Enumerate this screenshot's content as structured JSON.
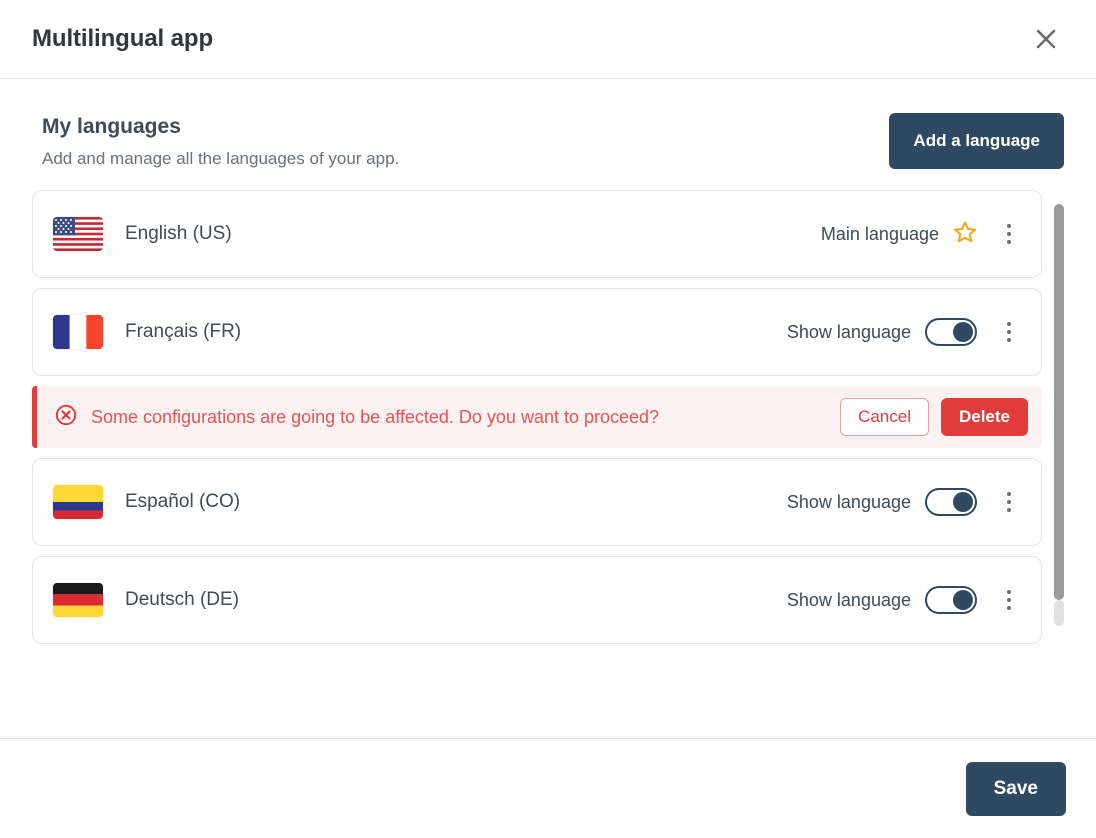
{
  "header": {
    "title": "Multilingual app",
    "close_icon": "close-icon"
  },
  "section": {
    "title": "My languages",
    "subtitle": "Add and manage all the languages of your app.",
    "add_button": "Add a language"
  },
  "languages": [
    {
      "name": "English (US)",
      "flag": "us",
      "status": "Main language",
      "control": "star",
      "star_icon": "star-icon",
      "menu_icon": "kebab-menu-icon"
    },
    {
      "name": "Français (FR)",
      "flag": "fr",
      "status": "Show language",
      "control": "toggle",
      "toggle_on": true,
      "menu_icon": "kebab-menu-icon"
    },
    {
      "name": "Español (CO)",
      "flag": "co",
      "status": "Show language",
      "control": "toggle",
      "toggle_on": true,
      "menu_icon": "kebab-menu-icon"
    },
    {
      "name": "Deutsch (DE)",
      "flag": "de",
      "status": "Show language",
      "control": "toggle",
      "toggle_on": true,
      "menu_icon": "kebab-menu-icon"
    }
  ],
  "alert": {
    "icon": "error-circle-x-icon",
    "message": "Some configurations are going to be affected. Do you want to proceed?",
    "cancel_label": "Cancel",
    "delete_label": "Delete"
  },
  "footer": {
    "save_label": "Save"
  },
  "colors": {
    "primary": "#2f4a60",
    "danger": "#e03c3c",
    "danger_bg": "#fdf2f2",
    "star": "#f5a623",
    "text": "#3f4b55",
    "muted": "#6b7278",
    "border": "#e2e5e8"
  }
}
